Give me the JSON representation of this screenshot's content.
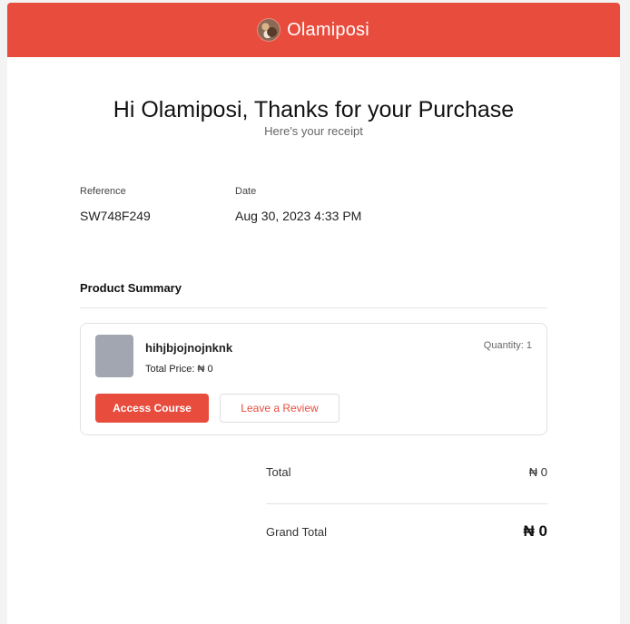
{
  "header": {
    "brand_name": "Olamiposi"
  },
  "hero": {
    "title": "Hi Olamiposi, Thanks for your Purchase",
    "subtitle": "Here's your receipt"
  },
  "meta": {
    "reference_label": "Reference",
    "reference_value": "SW748F249",
    "date_label": "Date",
    "date_value": "Aug 30, 2023 4:33 PM"
  },
  "summary": {
    "title": "Product Summary",
    "product": {
      "name": "hihjbjojnojnknk",
      "price_label": "Total Price:",
      "price_value": "₦ 0",
      "quantity_label": "Quantity:",
      "quantity_value": "1",
      "access_button": "Access Course",
      "review_button": "Leave a Review"
    }
  },
  "totals": {
    "total_label": "Total",
    "total_value": "₦ 0",
    "grand_label": "Grand Total",
    "grand_value": "₦ 0"
  },
  "colors": {
    "accent": "#e84c3d",
    "thumbnail": "#a1a6b0"
  }
}
